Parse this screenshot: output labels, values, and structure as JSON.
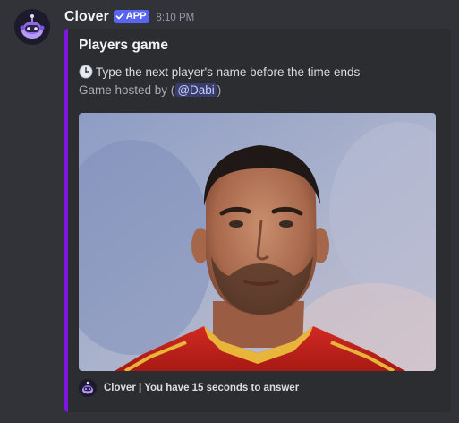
{
  "message": {
    "author": "Clover",
    "badge": "APP",
    "timestamp": "8:10 PM"
  },
  "embed": {
    "accent_color": "#7c16e0",
    "title": "Players game",
    "description": "Type the next player's name before the time ends",
    "description_icon": "clock-icon",
    "host_prefix": "Game hosted by (",
    "host_mention": "@Dabi",
    "host_suffix": ")",
    "image_icon": "player-portrait",
    "footer": {
      "icon": "clover-bot-icon",
      "text": "Clover | You have 15 seconds to answer"
    }
  }
}
